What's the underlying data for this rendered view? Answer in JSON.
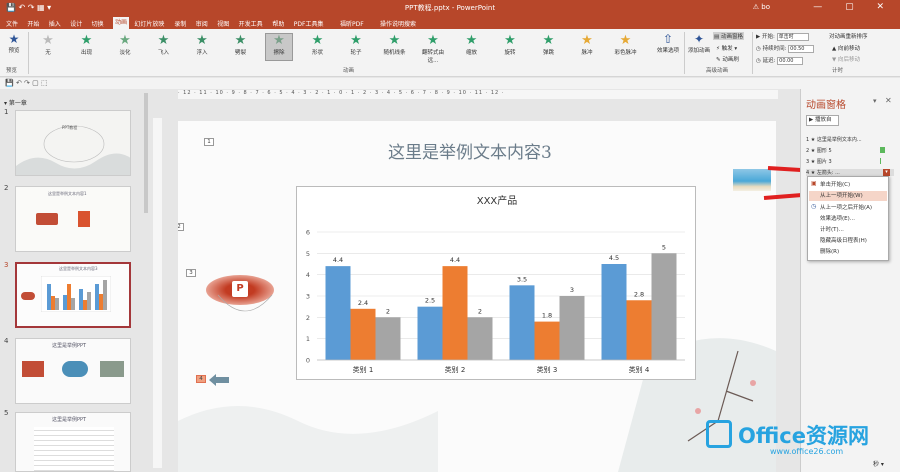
{
  "titlebar": {
    "title": "PPT教程.pptx - PowerPoint",
    "user": "bo",
    "win_controls": "— ▢ ✕",
    "qat": "💾 ↶ ↷ ▦ ▾"
  },
  "menu": {
    "tabs": [
      "文件",
      "开始",
      "插入",
      "设计",
      "切换",
      "动画",
      "幻灯片放映",
      "录制",
      "审阅",
      "视图",
      "开发工具",
      "帮助",
      "PDF工具集",
      "福昕PDF",
      "操作说明搜索"
    ],
    "active_index": 5
  },
  "ribbon": {
    "preview": "预览",
    "preview_group": "预览",
    "animations": [
      "无",
      "出现",
      "淡化",
      "飞入",
      "浮入",
      "劈裂",
      "擦除",
      "形状",
      "轮子",
      "随机线条",
      "翻转式由远...",
      "缩放",
      "旋转",
      "弹跳",
      "脉冲",
      "彩色脉冲"
    ],
    "selected_index": 6,
    "animation_group": "动画",
    "effect_options": "效果选项",
    "add_animation": "添加动画",
    "animation_pane": "动画窗格",
    "trigger": "触发",
    "animation_painter": "动画刷",
    "advanced_group": "高级动画",
    "start_label": "开始:",
    "start_value": "单击时",
    "duration_label": "持续时间:",
    "duration_value": "00.50",
    "delay_label": "延迟:",
    "delay_value": "00.00",
    "reorder": "对动画重新排序",
    "move_earlier": "向前移动",
    "move_later": "向后移动",
    "timing_group": "计时"
  },
  "thumbs": {
    "section": "第一章",
    "items": [
      {
        "num": "1",
        "title": "PPT教程"
      },
      {
        "num": "2",
        "title": "这里是举例文本内容1"
      },
      {
        "num": "3",
        "title": "这里是举例文本内容3"
      },
      {
        "num": "4",
        "title": "这里是举例PPT"
      },
      {
        "num": "5",
        "title": "这里是举例PPT"
      }
    ],
    "selected": 2
  },
  "ruler": {
    "h": "· 12 · 11 · 10 · 9 · 8 · 7 · 6 · 5 · 4 · 3 · 2 · 1 · 0 · 1 · 2 · 3 · 4 · 5 · 6 · 7 · 8 · 9 · 10 · 11 · 12 ·"
  },
  "slide": {
    "title": "这里是举例文本内容3",
    "tags": [
      "1",
      "2",
      "3",
      "4"
    ]
  },
  "chart_data": {
    "type": "bar",
    "title": "XXX产品",
    "categories": [
      "类别 1",
      "类别 2",
      "类别 3",
      "类别 4"
    ],
    "series": [
      {
        "values": [
          4.4,
          2.5,
          3.5,
          4.5
        ],
        "color": "#5b9bd5"
      },
      {
        "values": [
          2.4,
          4.4,
          1.8,
          2.8
        ],
        "color": "#ed7d31"
      },
      {
        "values": [
          2,
          2,
          3,
          5
        ],
        "color": "#a5a5a5"
      }
    ],
    "ylim": [
      0,
      6
    ],
    "yticks": [
      "0",
      "1",
      "2",
      "3",
      "4",
      "5",
      "6"
    ],
    "grid": true
  },
  "pane": {
    "title": "动画窗格",
    "close": "✕",
    "dropdown": "▾",
    "play": "▶ 播放自",
    "items": [
      {
        "num": "1",
        "label": "这里是举例文本内..."
      },
      {
        "num": "2",
        "label": "图形 5"
      },
      {
        "num": "3",
        "label": "图片 3"
      },
      {
        "num": "4",
        "label": "左箭头: ..."
      }
    ],
    "menu": [
      "单击开始(C)",
      "从上一项开始(W)",
      "从上一项之后开始(A)",
      "效果选项(E)...",
      "计时(T)...",
      "隐藏高级日程表(H)",
      "删除(R)"
    ],
    "menu_highlight": 1,
    "status": "秒 ▾"
  },
  "watermark": {
    "text": "Office资源网",
    "url": "www.office26.com"
  },
  "colors": {
    "accent": "#b7472a",
    "arrow": "#e02020"
  }
}
